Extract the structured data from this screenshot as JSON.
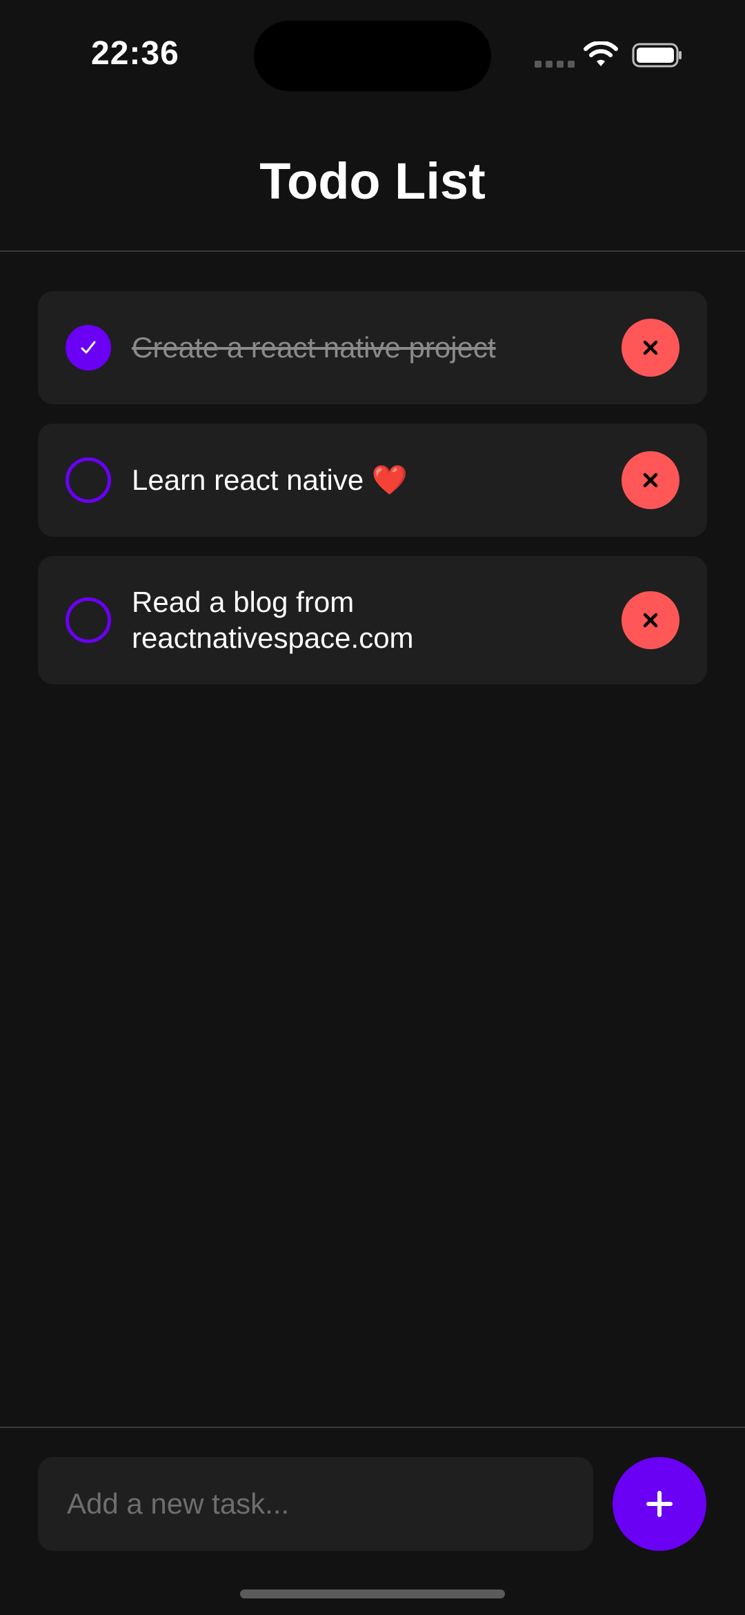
{
  "status_bar": {
    "time": "22:36"
  },
  "header": {
    "title": "Todo List"
  },
  "todos": [
    {
      "text": "Create a react native project",
      "completed": true
    },
    {
      "text": "Learn react native ❤️",
      "completed": false
    },
    {
      "text": "Read a blog from reactnativespace.com",
      "completed": false
    }
  ],
  "input": {
    "placeholder": "Add a new task...",
    "value": ""
  },
  "icons": {
    "check": "check-icon",
    "delete": "close-icon",
    "add": "plus-icon",
    "wifi": "wifi-icon",
    "battery": "battery-icon"
  },
  "colors": {
    "background": "#121212",
    "card": "#1f1f1f",
    "accent": "#6a00f4",
    "delete": "#ff5757",
    "muted_text": "#8a8a8a"
  }
}
